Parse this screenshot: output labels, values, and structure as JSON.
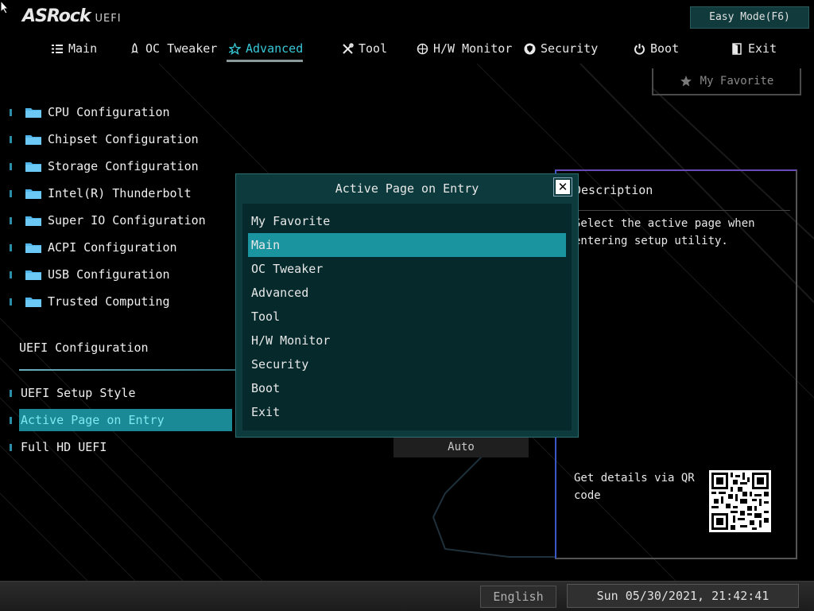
{
  "header": {
    "logo_main": "ASRock",
    "logo_sub": "UEFI",
    "easy_mode_label": "Easy Mode(F6)",
    "favorite_label": "My Favorite"
  },
  "nav": {
    "items": [
      {
        "label": "Main",
        "icon": "list-icon"
      },
      {
        "label": "OC Tweaker",
        "icon": "rocket-icon"
      },
      {
        "label": "Advanced",
        "icon": "star-icon",
        "active": true
      },
      {
        "label": "Tool",
        "icon": "tools-icon"
      },
      {
        "label": "H/W Monitor",
        "icon": "monitor-icon"
      },
      {
        "label": "Security",
        "icon": "shield-icon"
      },
      {
        "label": "Boot",
        "icon": "power-icon"
      },
      {
        "label": "Exit",
        "icon": "exit-icon"
      }
    ]
  },
  "menu": {
    "items": [
      {
        "label": "CPU Configuration"
      },
      {
        "label": "Chipset Configuration"
      },
      {
        "label": "Storage Configuration"
      },
      {
        "label": "Intel(R) Thunderbolt"
      },
      {
        "label": "Super IO Configuration"
      },
      {
        "label": "ACPI Configuration"
      },
      {
        "label": "USB Configuration"
      },
      {
        "label": "Trusted Computing"
      }
    ]
  },
  "uefi_section": {
    "title": "UEFI Configuration",
    "settings": [
      {
        "label": "UEFI Setup Style"
      },
      {
        "label": "Active Page on Entry",
        "selected": true
      },
      {
        "label": "Full HD UEFI",
        "value": "Auto"
      }
    ]
  },
  "description": {
    "title": "Description",
    "text": "Select the active page when entering setup utility.",
    "qr_text": "Get details via QR code"
  },
  "popup": {
    "title": "Active Page on Entry",
    "selected_index": 1,
    "options": [
      "My Favorite",
      "Main",
      "OC Tweaker",
      "Advanced",
      "Tool",
      "H/W Monitor",
      "Security",
      "Boot",
      "Exit"
    ]
  },
  "footer": {
    "language": "English",
    "datetime": "Sun 05/30/2021, 21:42:41"
  },
  "colors": {
    "accent": "#38c8d8",
    "selection": "#1a8a96",
    "popup_bg": "#0d3a3c"
  }
}
